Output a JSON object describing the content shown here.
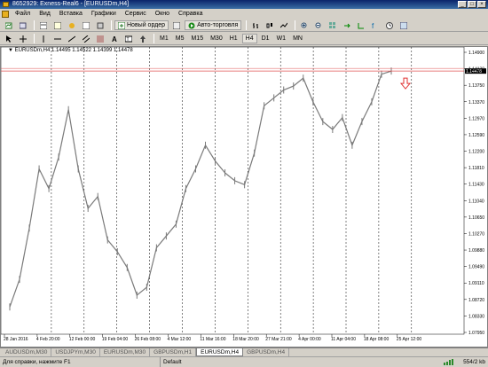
{
  "window": {
    "title": "8652929: Exness-Real6 - [EURUSDm,H4]"
  },
  "menu": [
    "Файл",
    "Вид",
    "Вставка",
    "Графики",
    "Сервис",
    "Окно",
    "Справка"
  ],
  "toolbar": {
    "new_order": "Новый ордер",
    "auto_trading": "Авто-торговля",
    "timeframes": [
      "M1",
      "M5",
      "M15",
      "M30",
      "H1",
      "H4",
      "D1",
      "W1",
      "MN"
    ]
  },
  "chart": {
    "header": "EURUSDm,H4  1.14495 1.14522 1.14399 1.14478",
    "current_price_label": "1.14478",
    "colors": {
      "bars": "#7a7a7a",
      "price_line": "#e05050",
      "arrow": "#e03030",
      "grid": "#000000"
    }
  },
  "chart_data": {
    "type": "line",
    "symbol": "EURUSDm",
    "timeframe": "H4",
    "y_ticks": [
      "1.14900",
      "1.14130",
      "1.13750",
      "1.13370",
      "1.12970",
      "1.12590",
      "1.12200",
      "1.11810",
      "1.11430",
      "1.11040",
      "1.10650",
      "1.10270",
      "1.09880",
      "1.09490",
      "1.09110",
      "1.08720",
      "1.08330",
      "1.07950"
    ],
    "x_ticks": [
      "28 Jan 2016",
      "4 Feb 20:00",
      "12 Feb 00:00",
      "19 Feb 04:00",
      "26 Feb 08:00",
      "4 Mar 12:00",
      "11 Mar 16:00",
      "18 Mar 20:00",
      "27 Mar 21:00",
      "4 Apr 00:00",
      "11 Apr 04:00",
      "18 Apr 08:00",
      "25 Apr 12:00"
    ],
    "ylim": [
      1.079,
      1.15
    ],
    "x": [
      "28 Jan 2016",
      "1 Feb",
      "3 Feb",
      "4 Feb 20:00",
      "8 Feb",
      "10 Feb",
      "12 Feb 00:00",
      "15 Feb",
      "17 Feb",
      "19 Feb 04:00",
      "22 Feb",
      "24 Feb",
      "26 Feb 08:00",
      "29 Feb",
      "2 Mar",
      "4 Mar 12:00",
      "7 Mar",
      "9 Mar",
      "11 Mar 16:00",
      "14 Mar",
      "16 Mar",
      "18 Mar 20:00",
      "22 Mar",
      "24 Mar",
      "27 Mar 21:00",
      "30 Mar",
      "1 Apr",
      "4 Apr 00:00",
      "6 Apr",
      "8 Apr",
      "11 Apr 04:00",
      "13 Apr",
      "15 Apr",
      "18 Apr 08:00",
      "20 Apr",
      "22 Apr",
      "25 Apr 12:00",
      "26 Apr",
      "27 Apr",
      "28 Apr"
    ],
    "values": [
      1.085,
      1.092,
      1.105,
      1.12,
      1.115,
      1.123,
      1.135,
      1.12,
      1.11,
      1.113,
      1.102,
      1.099,
      1.095,
      1.088,
      1.09,
      1.1,
      1.103,
      1.106,
      1.115,
      1.12,
      1.126,
      1.122,
      1.119,
      1.117,
      1.116,
      1.124,
      1.136,
      1.138,
      1.14,
      1.141,
      1.143,
      1.137,
      1.132,
      1.13,
      1.133,
      1.126,
      1.132,
      1.137,
      1.144,
      1.1448
    ]
  },
  "bottom_tabs": [
    "AUDUSDm,M30",
    "USDJPYm,M30",
    "EURUSDm,M30",
    "GBPUSDm,H1",
    "EURUSDm,H4",
    "GBPUSDm,H4"
  ],
  "active_tab": "EURUSDm,H4",
  "status": {
    "help": "Для справки, нажмите F1",
    "profile": "Default",
    "traffic": "554/2 kb"
  }
}
